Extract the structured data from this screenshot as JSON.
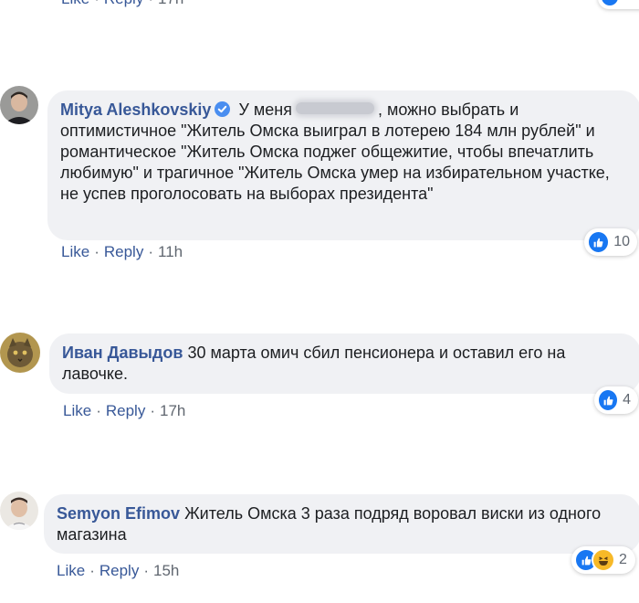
{
  "colors": {
    "link": "#385898",
    "time": "#606770",
    "bubble": "#f0f1f4",
    "like_blue": "#1877f2",
    "haha_yellow": "#f7b928"
  },
  "actions": {
    "like": "Like",
    "reply": "Reply",
    "separator": "·"
  },
  "top_partial": {
    "time": "17h"
  },
  "comments": [
    {
      "author": "Mitya Aleshkovskiy",
      "verified": true,
      "text_before": "У меня",
      "text_after": ", можно выбрать и оптимистичное \"Житель Омска выиграл в лотерею 184 млн рублей\" и романтическое \"Житель Омска поджег общежитие, чтобы впечатлить любимую\" и трагичное \"Житель Омска умер на избирательном участке, не успев проголосовать на выборах президента\"",
      "time": "11h",
      "reaction_icons": [
        "like-icon"
      ],
      "reaction_count": "10"
    },
    {
      "author": "Иван Давыдов",
      "verified": false,
      "text": "30 марта омич сбил пенсионера и оставил его на лавочке.",
      "time": "17h",
      "reaction_icons": [
        "like-icon"
      ],
      "reaction_count": "4"
    },
    {
      "author": "Semyon Efimov",
      "verified": false,
      "text": "Житель Омска 3 раза подряд воровал виски из одного магазина",
      "time": "15h",
      "reaction_icons": [
        "like-icon",
        "haha-icon"
      ],
      "reaction_count": "2"
    }
  ]
}
